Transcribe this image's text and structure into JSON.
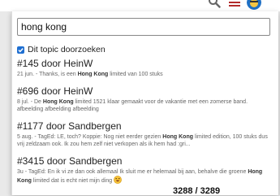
{
  "header": {
    "search_icon": "search-icon",
    "menu_icon": "hamburger-icon",
    "avatar_icon": "avatar-icon"
  },
  "search": {
    "value": "hong kong",
    "placeholder": ""
  },
  "filter": {
    "label": "Dit topic doorzoeken",
    "checked": true
  },
  "results": [
    {
      "title": "#145 door HeinW",
      "meta_before": "21 jun. - Thanks, is een ",
      "highlight": "Hong Kong",
      "meta_after": " limited van 100 stuks"
    },
    {
      "title": "#696 door HeinW",
      "meta_before": "8 jul. - De ",
      "highlight": "Hong Kong",
      "meta_after": " limited 1521 klaar gemaakt voor de vakantie met een zomerse band. afbeelding afbeelding afbeelding"
    },
    {
      "title": "#1177 door Sandbergen",
      "meta_before": "5 aug. - TagEd: LE, toch? Koppie: Nog niet eerder gezien ",
      "highlight": "Hong Kong",
      "meta_after": " limited edition, 100 stuks dus vrij zeldzaam ook. Ik zou hem zelf niet verkopen als ik hem had :gri..."
    },
    {
      "title": "#3415 door Sandbergen",
      "meta_before": "3u - TagEd: En ik vi ze dan ook allemaal Ik sluit me er helemaal bij aan, behalve die groene ",
      "highlight": "Hong Kong",
      "meta_after": " limited dat is echt niet mijn ding"
    }
  ],
  "background": {
    "partial_text": "3288 / 3289"
  },
  "colors": {
    "accent": "#1f6fd1",
    "panel": "#ffffff",
    "page": "#e9e9e9"
  }
}
